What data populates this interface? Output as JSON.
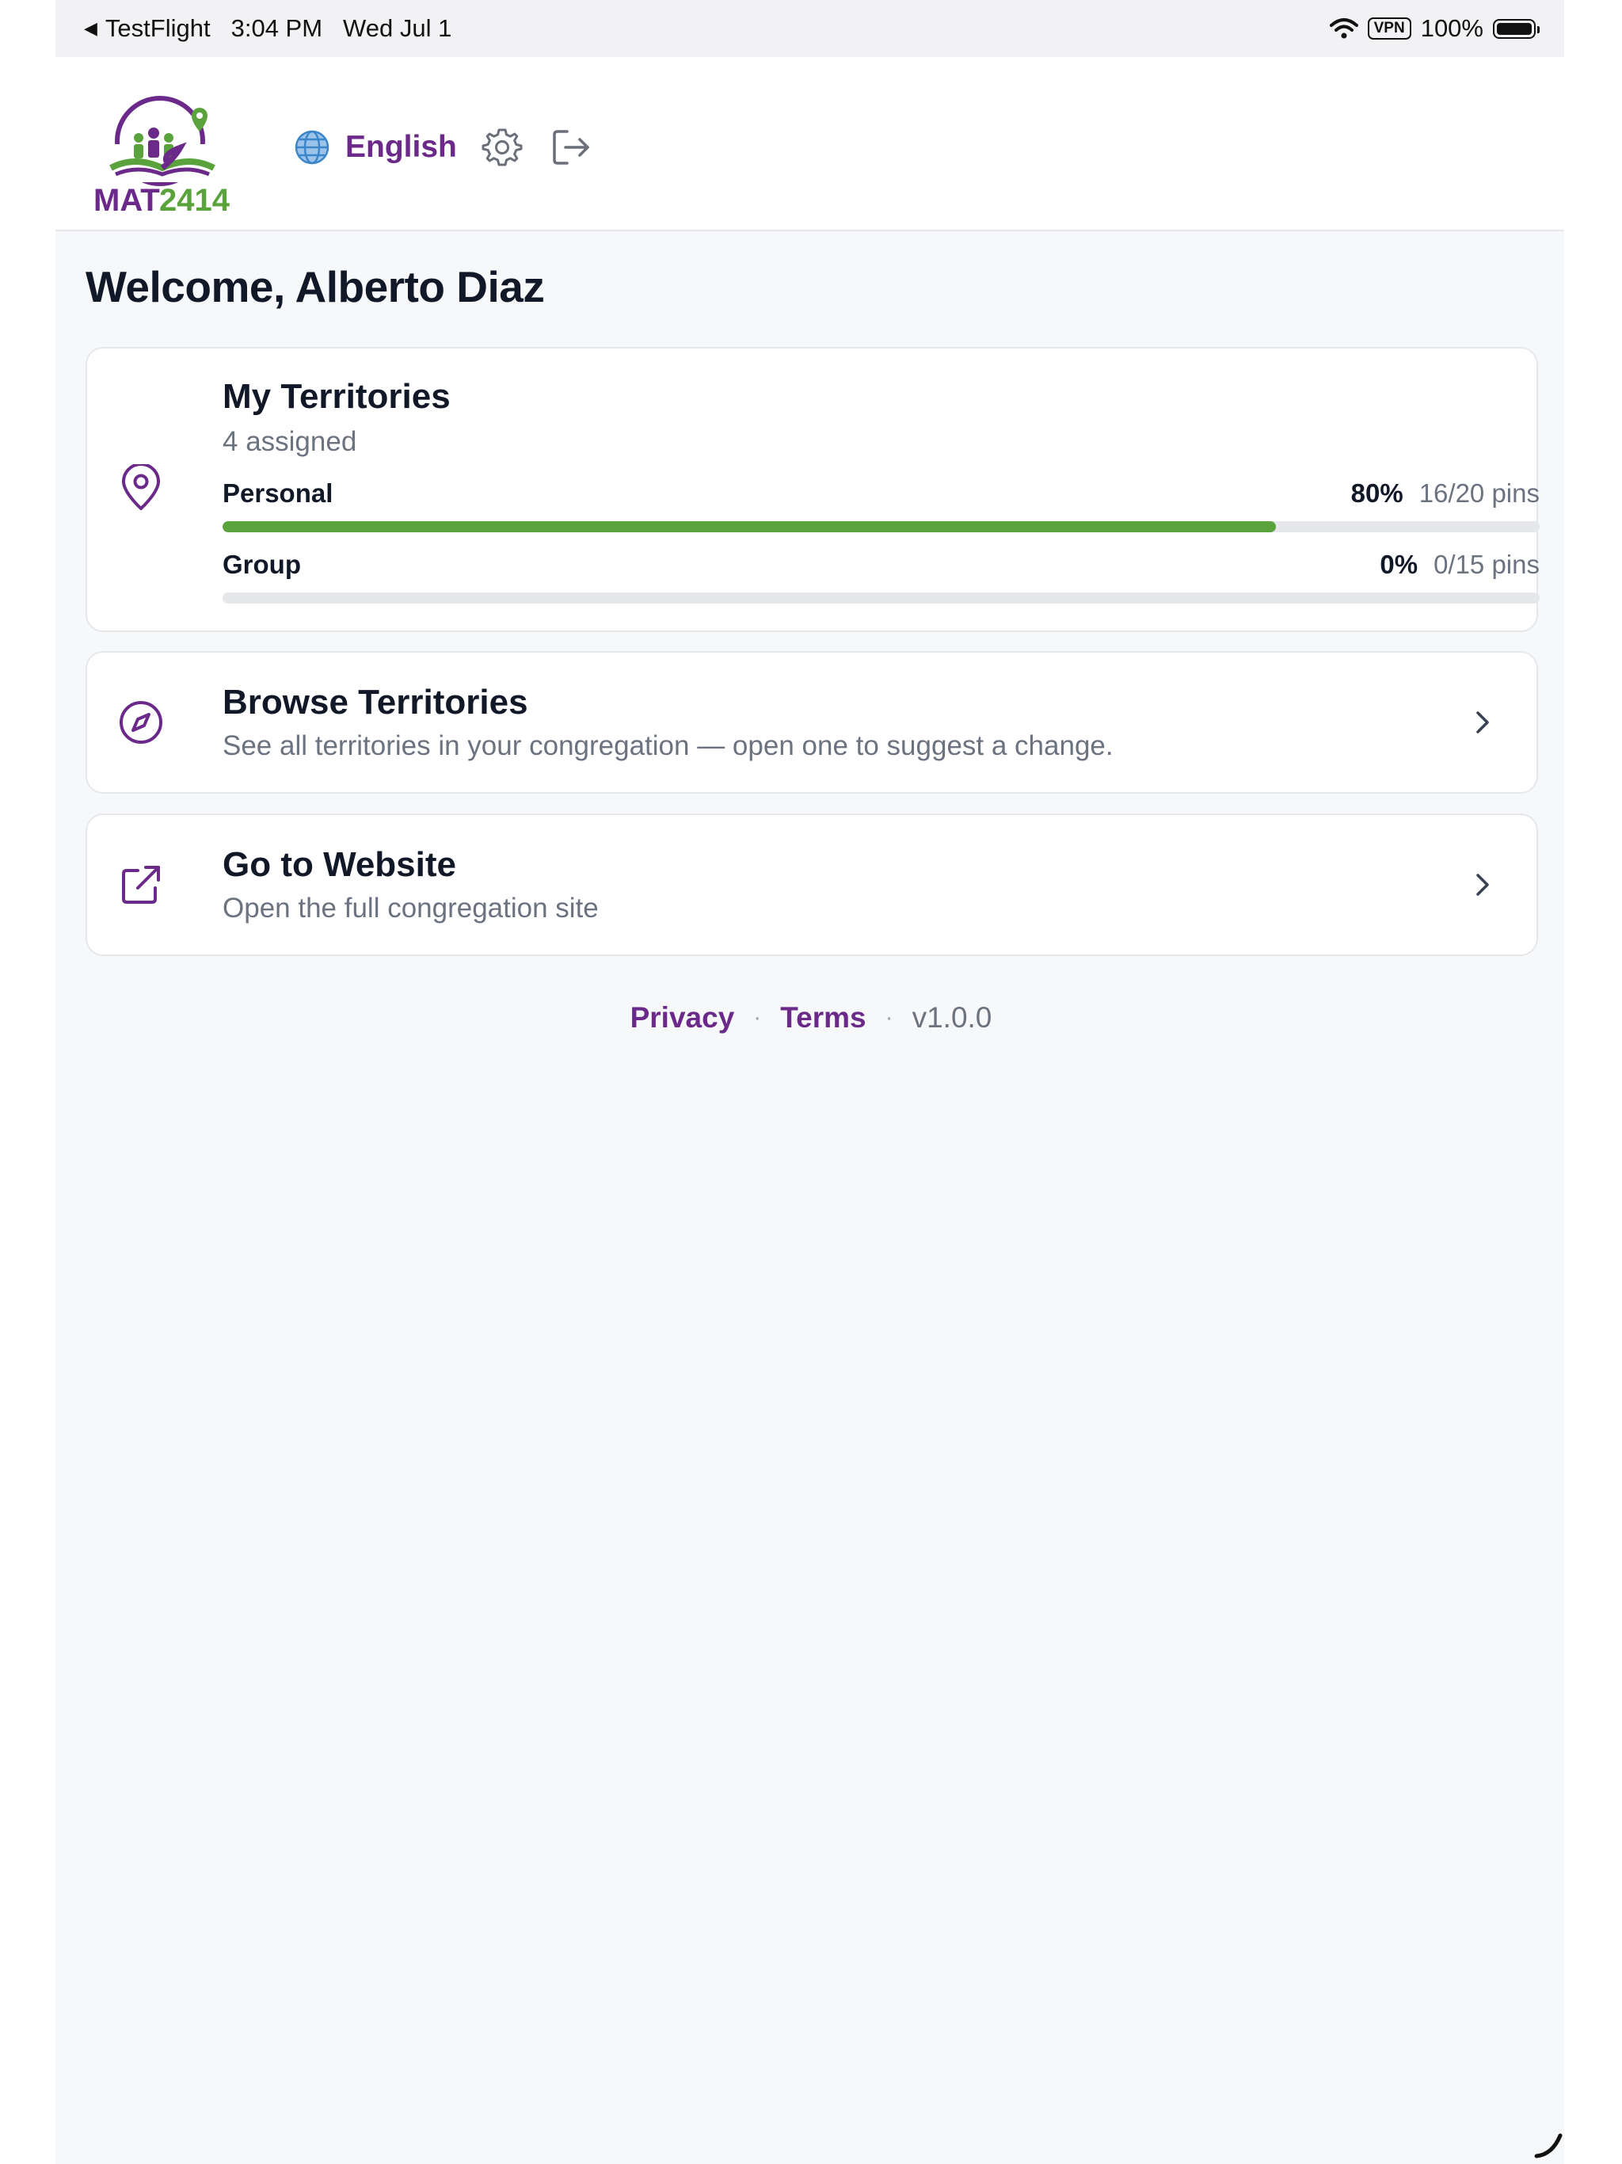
{
  "status_bar": {
    "back_glyph": "◀",
    "back_app": "TestFlight",
    "time": "3:04 PM",
    "date": "Wed Jul 1",
    "vpn": "VPN",
    "battery": "100%"
  },
  "header": {
    "logo_text_primary": "MAT",
    "logo_text_secondary": "2414",
    "language_label": "English",
    "icons": [
      "globe-icon",
      "gear-icon",
      "logout-icon"
    ]
  },
  "welcome": "Welcome, Alberto Diaz",
  "territories": {
    "title": "My Territories",
    "subtitle": "4 assigned",
    "icon": "map-pin-icon",
    "rows": [
      {
        "name": "Personal",
        "percent_label": "80%",
        "pins_label": "16/20 pins",
        "progress": 0.8
      },
      {
        "name": "Group",
        "percent_label": "0%",
        "pins_label": "0/15 pins",
        "progress": 0.0
      }
    ]
  },
  "browse": {
    "title": "Browse Territories",
    "subtitle": "See all territories in your congregation — open one to suggest a change.",
    "icon": "compass-icon"
  },
  "website": {
    "title": "Go to Website",
    "subtitle": "Open the full congregation site",
    "icon": "external-link-icon"
  },
  "footer": {
    "privacy": "Privacy",
    "terms": "Terms",
    "separator": "·",
    "version": "v1.0.0"
  },
  "colors": {
    "brand_purple": "#6b2a8a",
    "progress_green": "#5aa33c",
    "track_gray": "#e5e7eb",
    "background": "#f7f8fa"
  }
}
